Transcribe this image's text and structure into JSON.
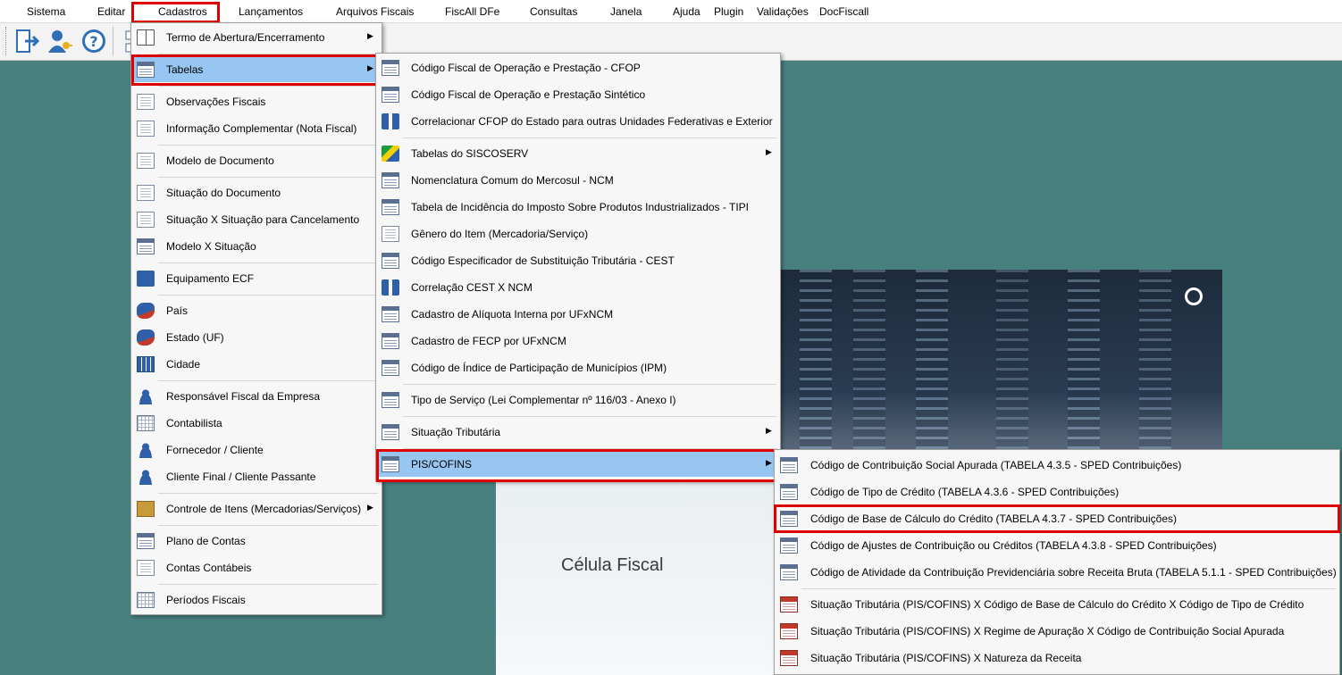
{
  "menubar": {
    "items": [
      "Sistema",
      "Editar",
      "Cadastros",
      "Lançamentos",
      "Arquivos Fiscais",
      "FiscAll DFe",
      "Consultas",
      "Janela",
      "Ajuda",
      "Plugin",
      "Validações",
      "DocFiscall"
    ]
  },
  "cadastros_menu": {
    "items": [
      {
        "label": "Termo de Abertura/Encerramento",
        "icon": "book-icon"
      },
      {
        "label": "Tabelas",
        "icon": "table-icon"
      },
      {
        "label": "Observações Fiscais",
        "icon": "document-binoculars-icon"
      },
      {
        "label": "Informação Complementar (Nota Fiscal)",
        "icon": "document-add-icon"
      },
      {
        "label": "Modelo de Documento",
        "icon": "document-icon"
      },
      {
        "label": "Situação do Documento",
        "icon": "document-info-icon"
      },
      {
        "label": "Situação X Situação para Cancelamento",
        "icon": "document-warning-icon"
      },
      {
        "label": "Modelo X Situação",
        "icon": "table-info-icon"
      },
      {
        "label": "Equipamento ECF",
        "icon": "ecf-icon"
      },
      {
        "label": "País",
        "icon": "country-map-icon"
      },
      {
        "label": "Estado (UF)",
        "icon": "state-map-icon"
      },
      {
        "label": "Cidade",
        "icon": "city-icon"
      },
      {
        "label": "Responsável Fiscal da Empresa",
        "icon": "person-icon"
      },
      {
        "label": "Contabilista",
        "icon": "grid-icon"
      },
      {
        "label": "Fornecedor / Cliente",
        "icon": "people-icon"
      },
      {
        "label": "Cliente Final / Cliente Passante",
        "icon": "person-icon"
      },
      {
        "label": "Controle de Itens (Mercadorias/Serviços)",
        "icon": "box-clock-icon"
      },
      {
        "label": "Plano de Contas",
        "icon": "chart-of-accounts-icon"
      },
      {
        "label": "Contas Contábeis",
        "icon": "accounts-icon"
      },
      {
        "label": "Períodos Fiscais",
        "icon": "calendar-icon"
      }
    ]
  },
  "tabelas_menu": {
    "items": [
      {
        "label": "Código Fiscal de Operação e Prestação - CFOP",
        "icon": "cfop-table-icon"
      },
      {
        "label": "Código Fiscal de Operação e Prestação Sintético",
        "icon": "cfop-table-icon"
      },
      {
        "label": "Correlacionar CFOP do Estado para outras Unidades Federativas e Exterior",
        "icon": "correlation-icon"
      },
      {
        "label": "Tabelas do SISCOSERV",
        "icon": "brazil-flag-icon"
      },
      {
        "label": "Nomenclatura Comum do Mercosul  - NCM",
        "icon": "ncm-table-icon"
      },
      {
        "label": "Tabela de Incidência do Imposto Sobre Produtos Industrializados - TIPI",
        "icon": "tipi-table-icon"
      },
      {
        "label": "Gênero do Item (Mercadoria/Serviço)",
        "icon": "money-doc-icon"
      },
      {
        "label": "Código Especificador de Substituição Tributária - CEST",
        "icon": "cest-table-icon"
      },
      {
        "label": "Correlação CEST X NCM",
        "icon": "correlation-icon"
      },
      {
        "label": "Cadastro de Alíquota Interna por UFxNCM",
        "icon": "money-table-icon"
      },
      {
        "label": "Cadastro de FECP por UFxNCM",
        "icon": "table-icon"
      },
      {
        "label": "Código de Índice de Participação de Municípios (IPM)",
        "icon": "table-add-icon"
      },
      {
        "label": "Tipo de Serviço (Lei Complementar nº 116/03 - Anexo I)",
        "icon": "table-tools-icon"
      },
      {
        "label": "Situação Tributária",
        "icon": "table-percent-icon"
      },
      {
        "label": "PIS/COFINS",
        "icon": "table-icon"
      }
    ]
  },
  "pis_cofins_menu": {
    "items": [
      {
        "label": "Código de Contribuição Social Apurada (TABELA 4.3.5 - SPED Contribuições)",
        "icon": "table-check-icon"
      },
      {
        "label": "Código de Tipo de Crédito (TABELA 4.3.6 - SPED Contribuições)",
        "icon": "table-money-icon"
      },
      {
        "label": "Código de Base de Cálculo do Crédito (TABELA 4.3.7 - SPED Contribuições)",
        "icon": "table-grid-icon"
      },
      {
        "label": "Código de Ajustes de Contribuição ou Créditos (TABELA 4.3.8 - SPED Contribuições)",
        "icon": "table-dollar-icon"
      },
      {
        "label": "Código de Atividade da Contribuição Previdenciária sobre Receita Bruta (TABELA 5.1.1 - SPED Contribuições)",
        "icon": "table-person-icon"
      },
      {
        "label": "Situação Tributária (PIS/COFINS)  X  Código de Base de Cálculo do Crédito  X  Código de Tipo de Crédito",
        "icon": "red-table-icon"
      },
      {
        "label": "Situação Tributária (PIS/COFINS)  X  Regime de Apuração  X  Código de Contribuição Social Apurada",
        "icon": "red-table-icon"
      },
      {
        "label": "Situação Tributária (PIS/COFINS)  X  Natureza da Receita",
        "icon": "red-table-icon"
      }
    ]
  },
  "splash": {
    "title": "Célula Fiscal"
  },
  "toolbar": {
    "icons": [
      "exit-icon",
      "user-key-icon",
      "help-icon",
      "network-icon"
    ]
  },
  "colors": {
    "highlight": "#e00000",
    "active_item": "#98c6f2",
    "desktop": "#488080"
  }
}
